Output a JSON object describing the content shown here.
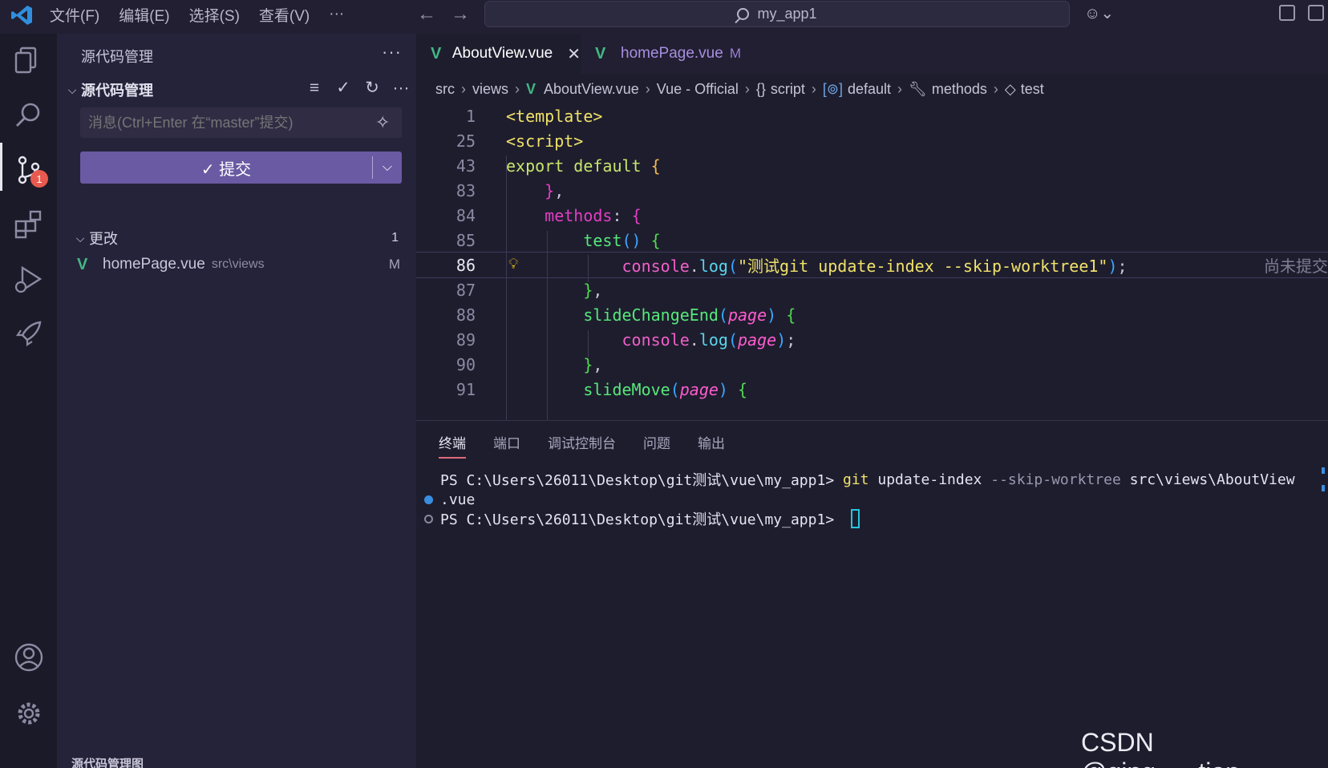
{
  "titlebar": {
    "menus": [
      "文件(F)",
      "编辑(E)",
      "选择(S)",
      "查看(V)",
      "···"
    ],
    "search_text": "my_app1"
  },
  "sidebar": {
    "view_title": "源代码管理",
    "section_title": "源代码管理",
    "message_placeholder": "消息(Ctrl+Enter 在“master”提交)",
    "commit_label": "✓ 提交",
    "changes_label": "更改",
    "changes_count": "1",
    "files": [
      {
        "name": "homePage.vue",
        "path": "src\\views",
        "status": "M"
      }
    ],
    "bottom_section": "源代码管理图"
  },
  "activity": {
    "scm_badge": "1"
  },
  "editor": {
    "tabs": [
      {
        "name": "AboutView.vue",
        "close": "✕",
        "active": true
      },
      {
        "name": "homePage.vue",
        "modified": "M",
        "active": false
      }
    ],
    "breadcrumb": [
      "src",
      "views",
      "AboutView.vue",
      "Vue - Official",
      "script",
      "default",
      "methods",
      "test"
    ],
    "line_numbers": [
      "1",
      "25",
      "43",
      "83",
      "84",
      "85",
      "86",
      "87",
      "88",
      "89",
      "90",
      "91"
    ],
    "blame_text": "尚未提交"
  },
  "panel": {
    "tabs": [
      "终端",
      "端口",
      "调试控制台",
      "问题",
      "输出"
    ],
    "prompt1": "PS C:\\Users\\26011\\Desktop\\git测试\\vue\\my_app1> ",
    "cmd_git": "git",
    "cmd_sub": " update-index ",
    "cmd_flag": "--skip-worktree",
    "cmd_path": " src\\views\\AboutView",
    "cmd_wrap": ".vue",
    "prompt2": "PS C:\\Users\\26011\\Desktop\\git测试\\vue\\my_app1> "
  },
  "watermark": "CSDN @qing___tian_"
}
